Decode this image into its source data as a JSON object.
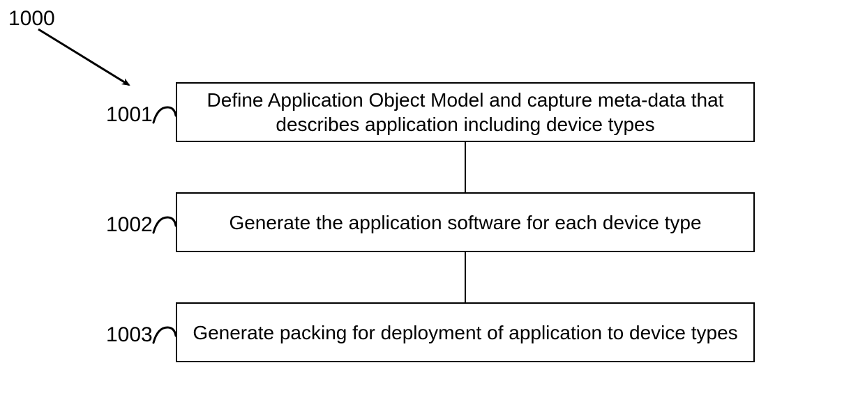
{
  "diagram": {
    "figure_ref": "1000",
    "steps": [
      {
        "ref": "1001",
        "text": "Define Application Object Model and capture meta-data that describes application including device types"
      },
      {
        "ref": "1002",
        "text": "Generate the application software for each device type"
      },
      {
        "ref": "1003",
        "text": "Generate packing for deployment of application to device types"
      }
    ]
  }
}
